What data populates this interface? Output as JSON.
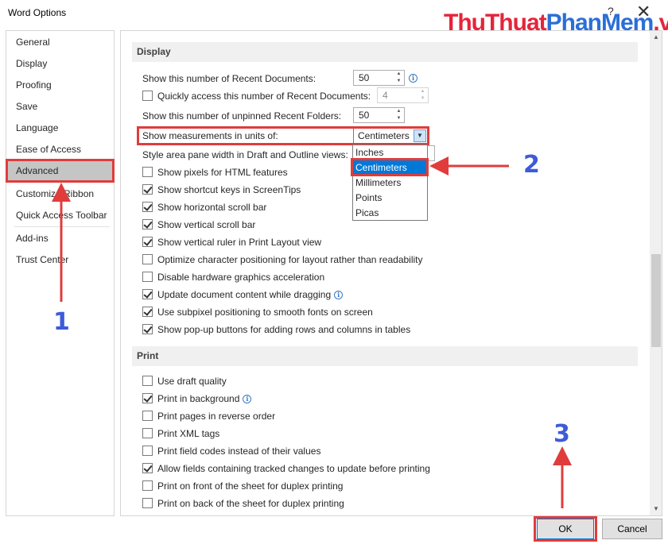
{
  "window": {
    "title": "Word Options",
    "help": "?",
    "close": "✕"
  },
  "watermark": {
    "part1": "ThuThuat",
    "part2": "PhanMem",
    "part3": ".vn"
  },
  "sidebar": {
    "items": [
      {
        "label": "General"
      },
      {
        "label": "Display"
      },
      {
        "label": "Proofing"
      },
      {
        "label": "Save"
      },
      {
        "label": "Language"
      },
      {
        "label": "Ease of Access"
      },
      {
        "label": "Advanced",
        "selected": true
      },
      {
        "label": "Customize Ribbon"
      },
      {
        "label": "Quick Access Toolbar"
      },
      {
        "label": "Add-ins"
      },
      {
        "label": "Trust Center"
      }
    ]
  },
  "display": {
    "header": "Display",
    "recent_docs_label": "Show this number of Recent Documents:",
    "recent_docs_value": "50",
    "quick_access_label": "Quickly access this number of Recent Documents:",
    "quick_access_value": "4",
    "unpinned_folders_label": "Show this number of unpinned Recent Folders:",
    "unpinned_folders_value": "50",
    "measurements_label": "Show measurements in units of:",
    "measurements_value": "Centimeters",
    "measurements_options": [
      "Inches",
      "Centimeters",
      "Millimeters",
      "Points",
      "Picas"
    ],
    "style_area_label": "Style area pane width in Draft and Outline views:",
    "checkboxes": [
      {
        "label": "Show pixels for HTML features",
        "checked": false
      },
      {
        "label": "Show shortcut keys in ScreenTips",
        "checked": true
      },
      {
        "label": "Show horizontal scroll bar",
        "checked": true
      },
      {
        "label": "Show vertical scroll bar",
        "checked": true
      },
      {
        "label": "Show vertical ruler in Print Layout view",
        "checked": true
      },
      {
        "label": "Optimize character positioning for layout rather than readability",
        "checked": false
      },
      {
        "label": "Disable hardware graphics acceleration",
        "checked": false
      },
      {
        "label": "Update document content while dragging",
        "checked": true
      },
      {
        "label": "Use subpixel positioning to smooth fonts on screen",
        "checked": true
      },
      {
        "label": "Show pop-up buttons for adding rows and columns in tables",
        "checked": true
      }
    ]
  },
  "print": {
    "header": "Print",
    "checkboxes": [
      {
        "label": "Use draft quality",
        "checked": false
      },
      {
        "label": "Print in background",
        "checked": true
      },
      {
        "label": "Print pages in reverse order",
        "checked": false
      },
      {
        "label": "Print XML tags",
        "checked": false
      },
      {
        "label": "Print field codes instead of their values",
        "checked": false
      },
      {
        "label": "Allow fields containing tracked changes to update before printing",
        "checked": true
      },
      {
        "label": "Print on front of the sheet for duplex printing",
        "checked": false
      },
      {
        "label": "Print on back of the sheet for duplex printing",
        "checked": false
      }
    ]
  },
  "buttons": {
    "ok": "OK",
    "cancel": "Cancel"
  },
  "annotations": {
    "step1": "1",
    "step2": "2",
    "step3": "3"
  },
  "colors": {
    "annotation_red": "#e03c3c",
    "annotation_blue": "#3d5bd9",
    "selection_blue": "#0078d7"
  }
}
